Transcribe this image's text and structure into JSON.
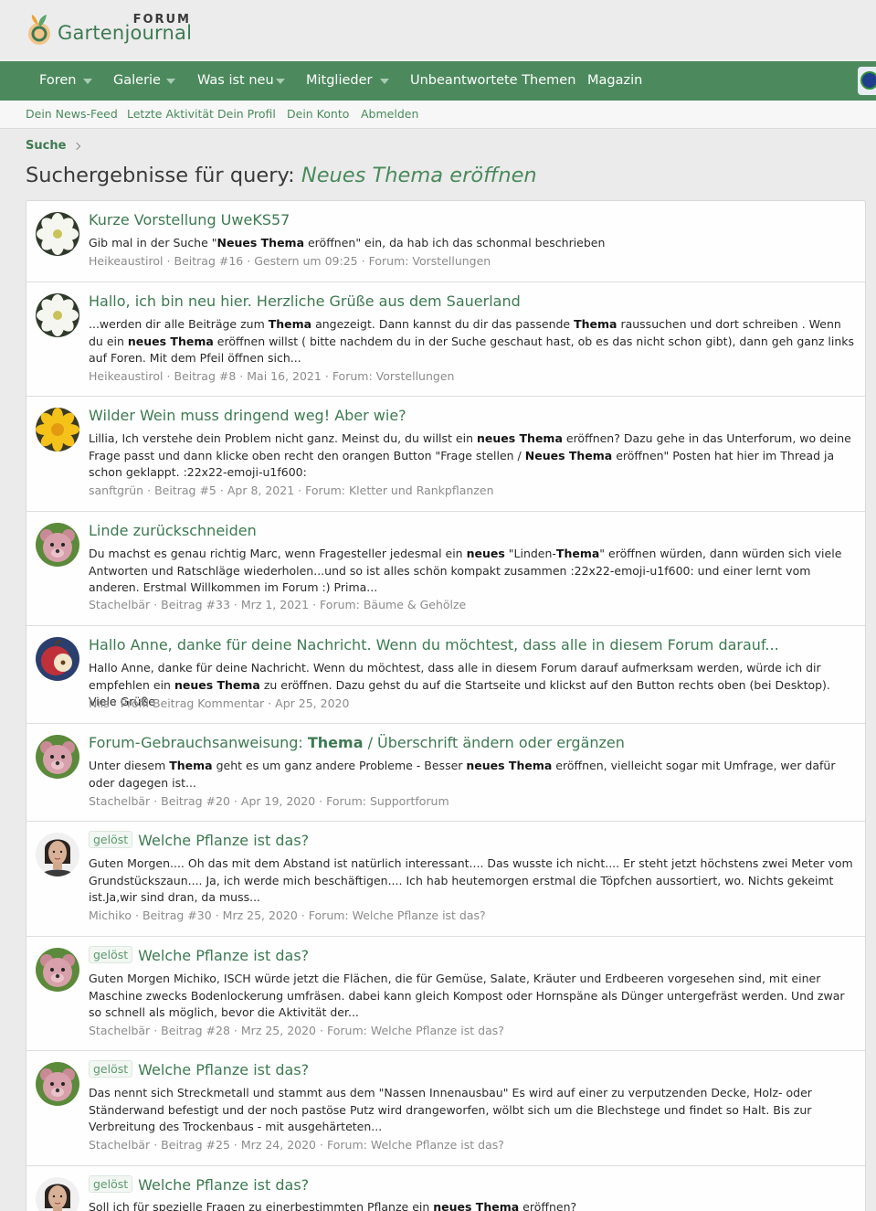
{
  "site": {
    "logo_forum": "FORUM",
    "logo_name": "Gartenjournal"
  },
  "nav": [
    {
      "label": "Foren",
      "has_menu": true
    },
    {
      "label": "Galerie",
      "has_menu": true
    },
    {
      "label": "Was ist neu",
      "has_menu": true
    },
    {
      "label": "Mitglieder",
      "has_menu": true
    },
    {
      "label": "Unbeantwortete Themen",
      "has_menu": false
    },
    {
      "label": "Magazin",
      "has_menu": false
    }
  ],
  "subnav": [
    "Dein News-Feed",
    "Letzte Aktivität",
    "Dein Profil",
    "Dein Konto",
    "Abmelden"
  ],
  "breadcrumb": "Suche",
  "page_title": {
    "prefix": "Suchergebnisse für query: ",
    "query": "Neues Thema eröffnen"
  },
  "results": [
    {
      "avatar": "white-flower",
      "title": "Kurze Vorstellung UweKS57",
      "snippet_html": "Gib mal in der Suche \"<b>Neues Thema</b> eröffnen\" ein, da hab ich das schonmal beschrieben",
      "meta": [
        "Heikeaustirol",
        "Beitrag #16",
        "Gestern um 09:25",
        "Forum: Vorstellungen"
      ]
    },
    {
      "avatar": "white-flower",
      "title": "Hallo, ich bin neu hier. Herzliche Grüße aus dem Sauerland",
      "snippet_html": "...werden dir alle Beiträge zum <b>Thema</b> angezeigt. Dann kannst du dir das passende <b>Thema</b> raussuchen und dort schreiben . Wenn du ein <b>neues Thema</b> eröffnen willst ( bitte nachdem du in der Suche geschaut hast, ob es das nicht schon gibt), dann geh ganz links auf Foren. Mit dem Pfeil öffnen sich...",
      "meta": [
        "Heikeaustirol",
        "Beitrag #8",
        "Mai 16, 2021",
        "Forum: Vorstellungen"
      ]
    },
    {
      "avatar": "yellow-flower",
      "title": "Wilder Wein muss dringend weg! Aber wie?",
      "snippet_html": "Lillia, Ich verstehe dein Problem nicht ganz. Meinst du, du willst ein <b>neues Thema</b> eröffnen? Dazu gehe in das Unterforum, wo deine Frage passt und dann klicke oben recht den orangen Button \"Frage stellen / <b>Neues Thema</b> eröffnen\" Posten hat hier im Thread ja schon geklappt. :22x22-emoji-u1f600:",
      "meta": [
        "sanftgrün",
        "Beitrag #5",
        "Apr 8, 2021",
        "Forum: Kletter und Rankpflanzen"
      ]
    },
    {
      "avatar": "teddy",
      "title": "Linde zurückschneiden",
      "snippet_html": "Du machst es genau richtig Marc, wenn Fragesteller jedesmal ein <b>neues</b> \"Linden-<b>Thema</b>\" eröffnen würden, dann würden sich viele Antworten und Ratschläge wiederholen...und so ist alles schön kompakt zusammen :22x22-emoji-u1f600: und einer lernt vom anderen. Erstmal Willkommen im Forum :) Prima...",
      "meta": [
        "Stachelbär",
        "Beitrag #33",
        "Mrz 1, 2021",
        "Forum: Bäume & Gehölze"
      ]
    },
    {
      "avatar": "apple",
      "title": "Hallo Anne, danke für deine Nachricht. Wenn du möchtest, dass alle in diesem Forum darauf...",
      "snippet_html": "Hallo Anne, danke für deine Nachricht. Wenn du möchtest, dass alle in diesem Forum darauf aufmerksam werden, würde ich dir empfehlen ein <b>neues Thema</b> zu eröffnen. Dazu gehst du auf die Startseite und klickst auf den Button rechts oben (bei Desktop). Viele Grüße",
      "meta": [
        "Nils",
        "Profil Beitrag Kommentar",
        "Apr 25, 2020"
      ]
    },
    {
      "avatar": "teddy",
      "title_html": "Forum-Gebrauchsanweisung: <b>Thema</b> / Überschrift ändern oder ergänzen",
      "snippet_html": "Unter diesem <b>Thema</b> geht es um ganz andere Probleme - Besser <b>neues Thema</b> eröffnen, vielleicht sogar mit Umfrage, wer dafür oder dagegen ist...",
      "meta": [
        "Stachelbär",
        "Beitrag #20",
        "Apr 19, 2020",
        "Forum: Supportforum"
      ]
    },
    {
      "avatar": "person",
      "badge": "gelöst",
      "title": "Welche Pflanze ist das?",
      "snippet_html": "Guten Morgen.... Oh das mit dem Abstand ist natürlich interessant.... Das wusste ich nicht.... Er steht jetzt höchstens zwei Meter vom Grundstückszaun.... Ja, ich werde mich beschäftigen.... Ich hab heutemorgen erstmal die Töpfchen aussortiert, wo. Nichts gekeimt ist.Ja,wir sind dran, da muss...",
      "meta": [
        "Michiko",
        "Beitrag #30",
        "Mrz 25, 2020",
        "Forum: Welche Pflanze ist das?"
      ]
    },
    {
      "avatar": "teddy",
      "badge": "gelöst",
      "title": "Welche Pflanze ist das?",
      "snippet_html": "Guten Morgen Michiko, ISCH würde jetzt die Flächen, die für Gemüse, Salate, Kräuter und Erdbeeren vorgesehen sind, mit einer Maschine zwecks Bodenlockerung umfräsen. dabei kann gleich Kompost oder Hornspäne als Dünger untergefräst werden. Und zwar so schnell als möglich, bevor die Aktivität der...",
      "meta": [
        "Stachelbär",
        "Beitrag #28",
        "Mrz 25, 2020",
        "Forum: Welche Pflanze ist das?"
      ]
    },
    {
      "avatar": "teddy",
      "badge": "gelöst",
      "title": "Welche Pflanze ist das?",
      "snippet_html": "Das nennt sich Streckmetall und stammt aus dem \"Nassen Innenausbau\" Es wird auf einer zu verputzenden Decke, Holz- oder Ständerwand befestigt und der noch pastöse Putz wird drangeworfen, wölbt sich um die Blechstege und findet so Halt. Bis zur Verbreitung des Trockenbaus - mit ausgehärteten...",
      "meta": [
        "Stachelbär",
        "Beitrag #25",
        "Mrz 24, 2020",
        "Forum: Welche Pflanze ist das?"
      ]
    },
    {
      "avatar": "person",
      "badge": "gelöst",
      "title": "Welche Pflanze ist das?",
      "snippet_html": "Soll ich für spezielle Fragen zu einerbestimmten Pflanze ein <b>neues Thema</b> eröffnen?",
      "meta": []
    }
  ]
}
